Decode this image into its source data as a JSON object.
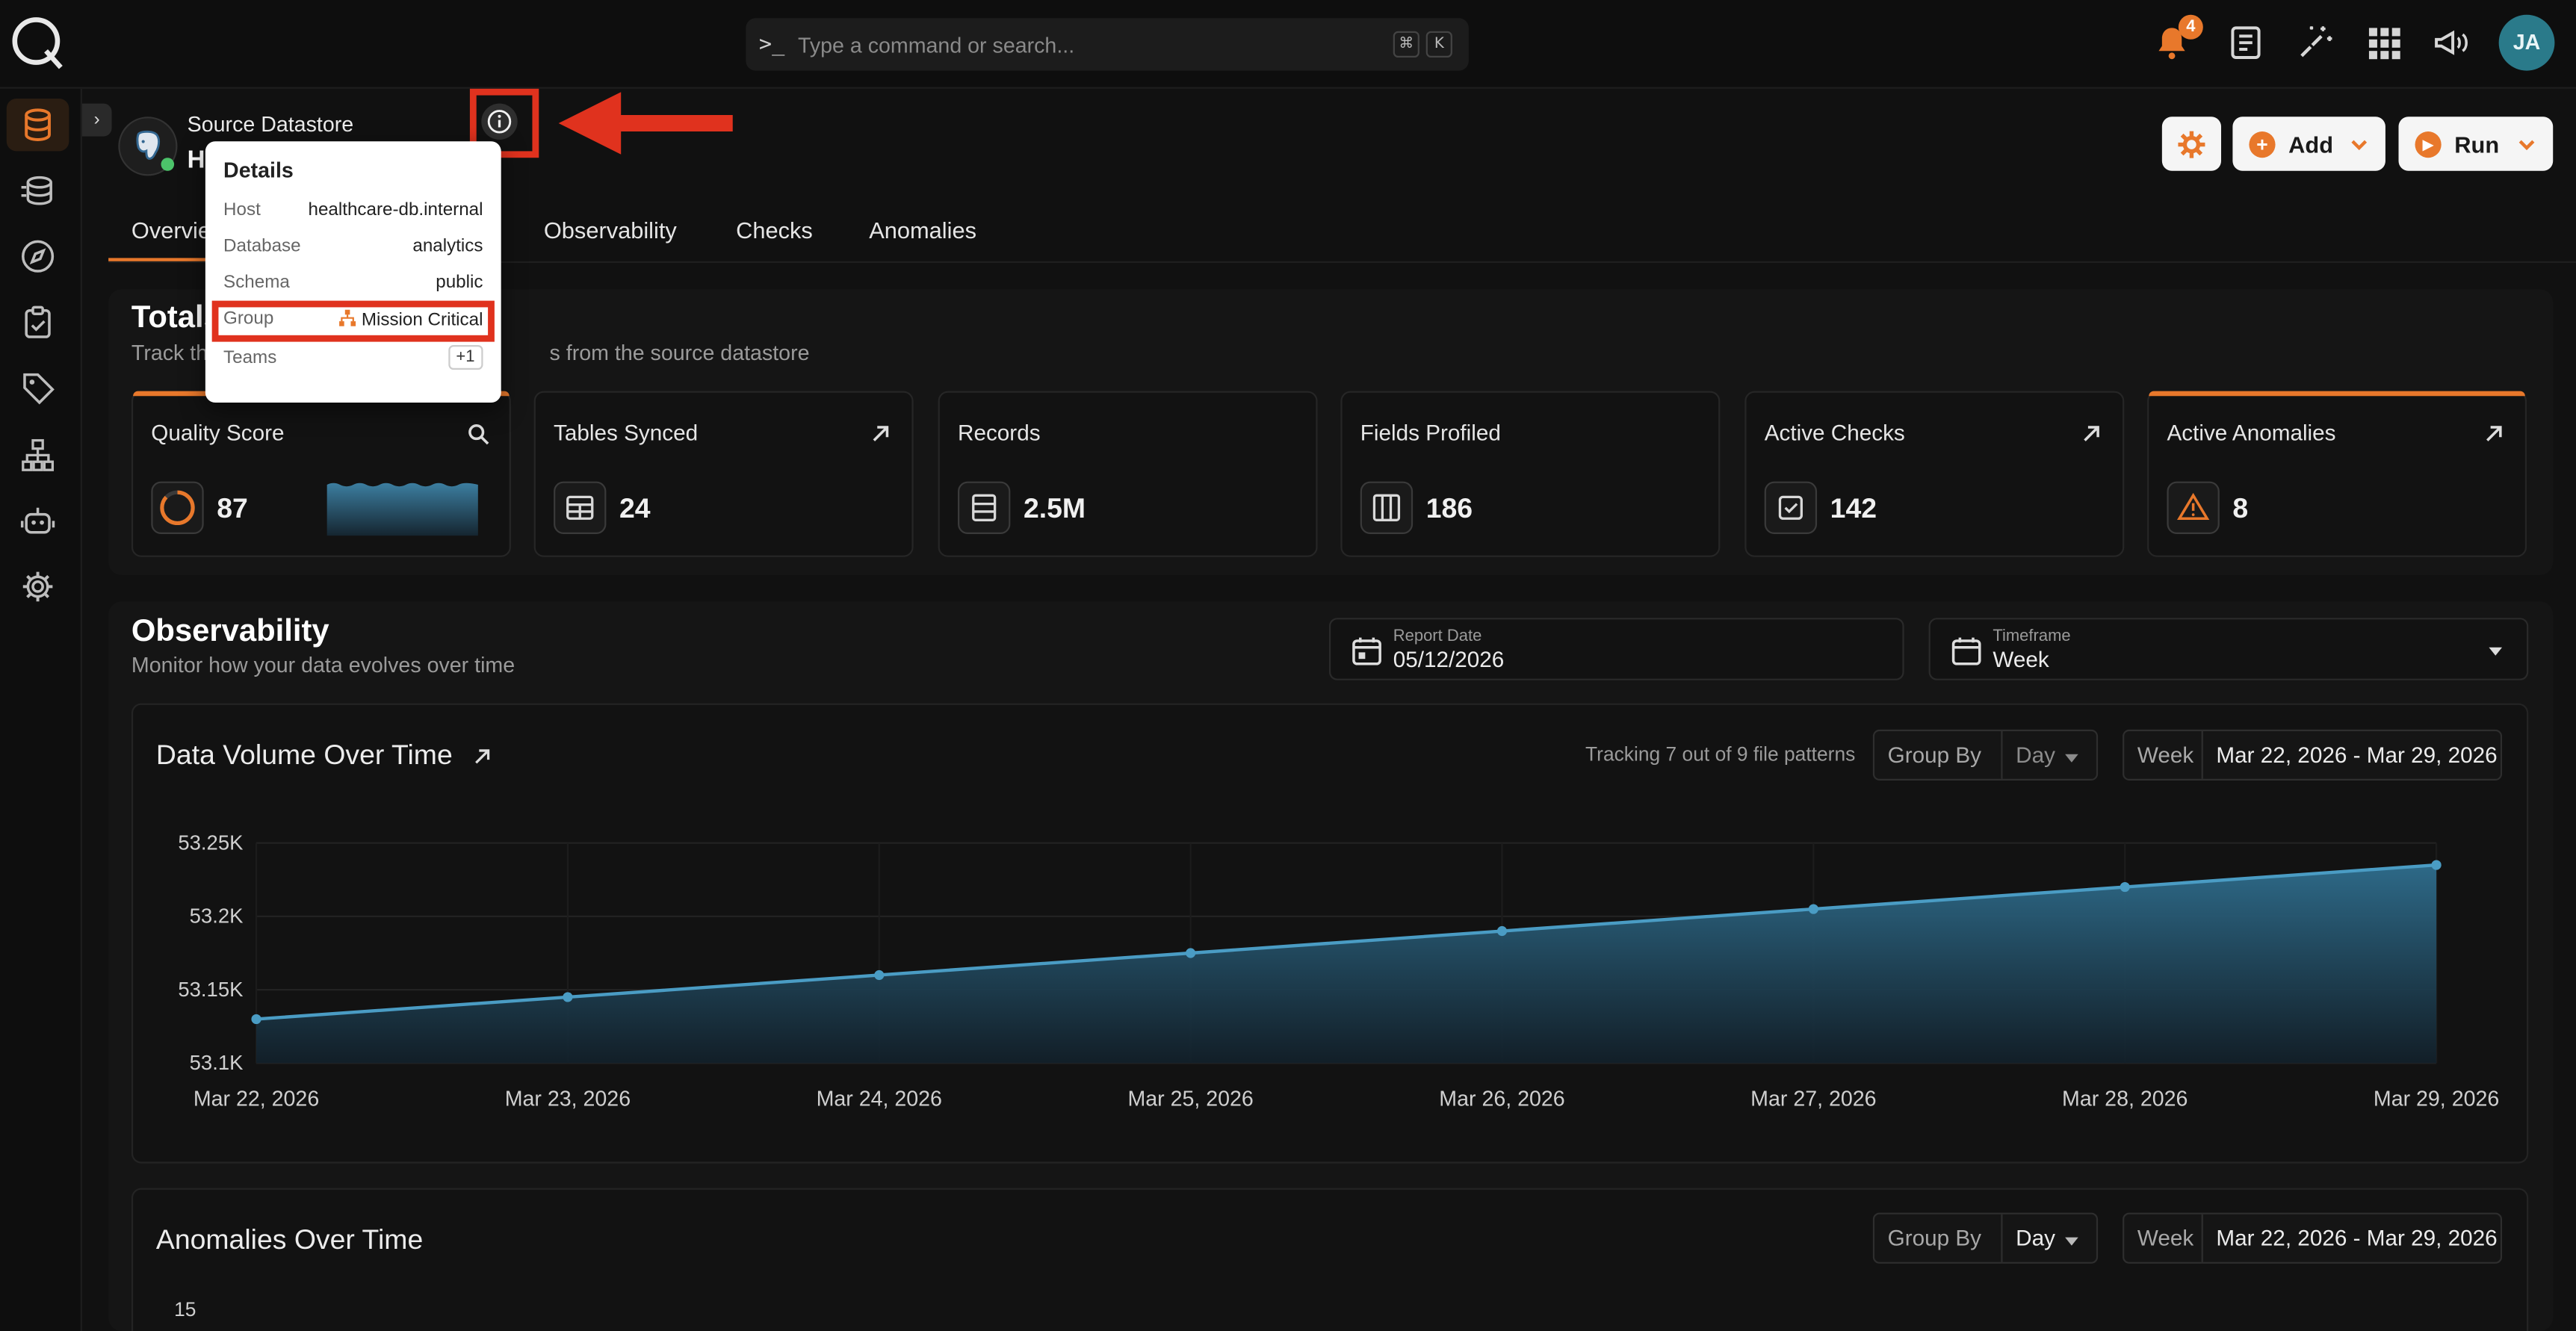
{
  "topbar": {
    "command_placeholder": "Type a command or search...",
    "prompt_glyph": ">_",
    "kbd_cmd": "⌘",
    "kbd_k": "K",
    "notification_count": "4",
    "avatar_initials": "JA"
  },
  "header": {
    "datastore_type": "Source Datastore",
    "datastore_name": "H",
    "add_label": "Add",
    "run_label": "Run"
  },
  "tabs": [
    {
      "label": "Overview"
    },
    {
      "label": "Observability"
    },
    {
      "label": "Checks"
    },
    {
      "label": "Anomalies"
    }
  ],
  "details": {
    "title": "Details",
    "rows": [
      {
        "key": "Host",
        "value": "healthcare-db.internal"
      },
      {
        "key": "Database",
        "value": "analytics"
      },
      {
        "key": "Schema",
        "value": "public"
      },
      {
        "key": "Group",
        "value": "Mission Critical"
      },
      {
        "key": "Teams",
        "value": "+1"
      }
    ]
  },
  "totals": {
    "title": "Totals",
    "subtitle_left": "Track th",
    "subtitle_right": "s from the source datastore",
    "cards": [
      {
        "title": "Quality Score",
        "value": "87"
      },
      {
        "title": "Tables Synced",
        "value": "24"
      },
      {
        "title": "Records",
        "value": "2.5M"
      },
      {
        "title": "Fields Profiled",
        "value": "186"
      },
      {
        "title": "Active Checks",
        "value": "142"
      },
      {
        "title": "Active Anomalies",
        "value": "8"
      }
    ]
  },
  "observability": {
    "title": "Observability",
    "subtitle": "Monitor how your data evolves over time",
    "report_date_label": "Report Date",
    "report_date_value": "05/12/2026",
    "timeframe_label": "Timeframe",
    "timeframe_value": "Week"
  },
  "volume_panel": {
    "title": "Data Volume Over Time",
    "tracking": "Tracking 7 out of 9 file patterns",
    "group_by_label": "Group By",
    "group_by_value": "Day",
    "week_label": "Week",
    "week_range": "Mar 22, 2026 - Mar 29, 2026"
  },
  "anomalies_panel": {
    "title": "Anomalies Over Time",
    "group_by_label": "Group By",
    "group_by_value": "Day",
    "week_label": "Week",
    "week_range": "Mar 22, 2026 - Mar 29, 2026",
    "y_top": "15"
  },
  "chart_data": {
    "type": "area",
    "x": [
      "Mar 22, 2026",
      "Mar 23, 2026",
      "Mar 24, 2026",
      "Mar 25, 2026",
      "Mar 26, 2026",
      "Mar 27, 2026",
      "Mar 28, 2026",
      "Mar 29, 2026"
    ],
    "values": [
      53130,
      53145,
      53160,
      53175,
      53190,
      53205,
      53220,
      53235
    ],
    "yticks": [
      53100,
      53150,
      53200,
      53250
    ],
    "ytick_labels": [
      "53.1K",
      "53.15K",
      "53.2K",
      "53.25K"
    ],
    "ylim": [
      53100,
      53250
    ],
    "grid": true,
    "line_color": "#4a9cc4"
  },
  "colors": {
    "accent": "#e8782b",
    "highlight": "#e0321e"
  }
}
